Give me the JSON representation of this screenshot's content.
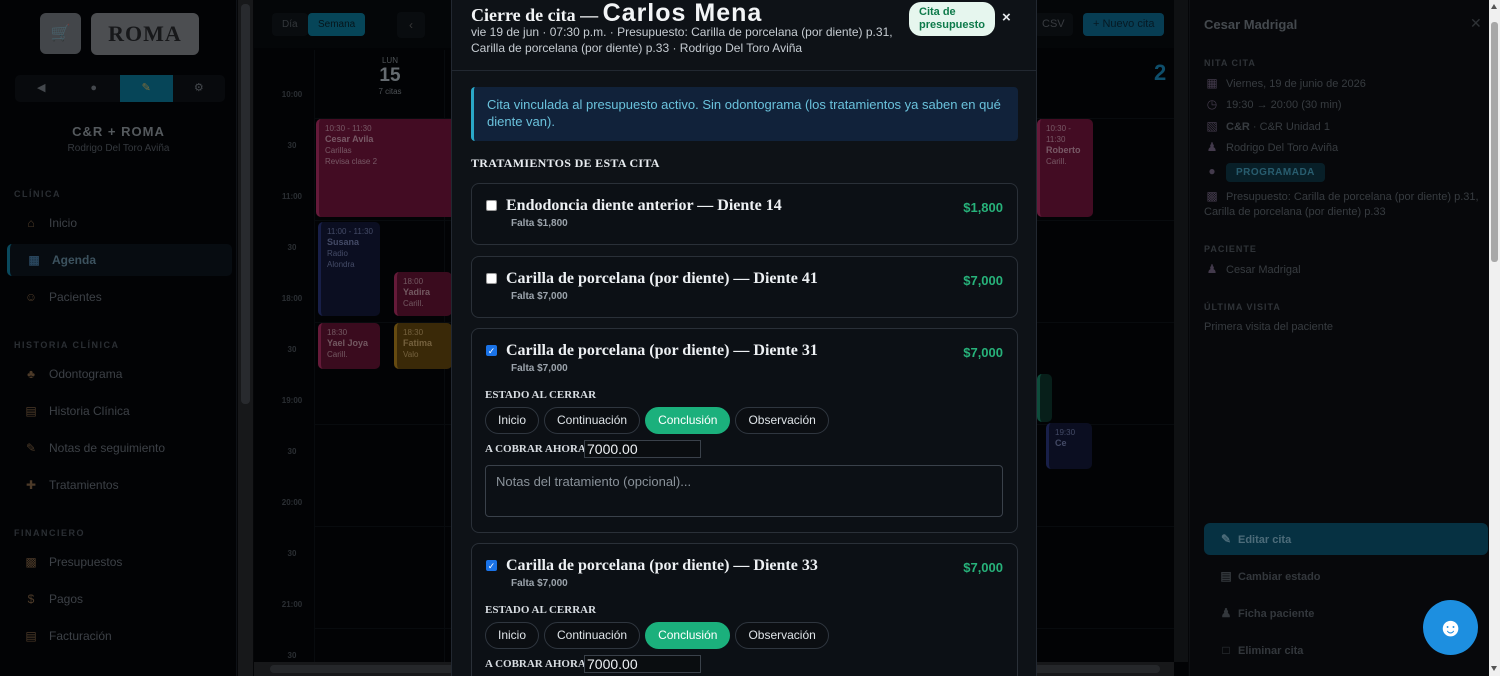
{
  "sidebar": {
    "logo_text": "ROMA",
    "clinic_name": "C&R + ROMA",
    "doctor": "Rodrigo Del Toro Aviña",
    "sections": {
      "clinica": "CLÍNICA",
      "historia": "HISTORIA CLÍNICA",
      "financiero": "FINANCIERO"
    },
    "nav": {
      "inicio": "Inicio",
      "agenda": "Agenda",
      "pacientes": "Pacientes",
      "odontograma": "Odontograma",
      "historia_clinica": "Historia Clínica",
      "notas": "Notas de seguimiento",
      "tratamientos": "Tratamientos",
      "presupuestos": "Presupuestos",
      "pagos": "Pagos",
      "facturacion": "Facturación"
    }
  },
  "calendar": {
    "view_day": "Día",
    "view_week": "Semana",
    "csv": "CSV",
    "new_appt": "+ Nuevo cita",
    "day_head": {
      "dow": "LUN",
      "num": "15",
      "count": "7 citas"
    },
    "times": [
      "10:00",
      "30",
      "11:00",
      "30",
      "18:00",
      "30",
      "19:00",
      "30",
      "20:00",
      "30",
      "21:00",
      "30"
    ],
    "events": {
      "e1": {
        "t": "10:30 - 11:30",
        "n": "Cesar Avila",
        "s": "Carillas",
        "x": "Revisa clase 2"
      },
      "e2": {
        "t": "11:00 - 11:30",
        "n": "Susana",
        "s": "Radio",
        "x": "Alondra"
      },
      "e3": {
        "t": "18:00",
        "n": "Yadira",
        "s": "Carill."
      },
      "e4": {
        "t": "18:30",
        "n": "Yael Joya",
        "s": "Carill."
      },
      "e5": {
        "t": "18:30",
        "n": "Fatima",
        "s": "Valo"
      },
      "e6": {
        "t": "10:30 - 11:30",
        "n": "Roberto",
        "s": "Carill."
      },
      "e7": {
        "t": "19:30",
        "n": "Ce"
      }
    }
  },
  "panel": {
    "title": "Cesar Madrigal",
    "cita_label": "NITA CITA",
    "date": "Viernes, 19 de junio de 2026",
    "time": "19:30 → 20:00 (30 min)",
    "unit_bold": "C&R",
    "unit": "· C&R Unidad 1",
    "doctor": "Rodrigo Del Toro Aviña",
    "status": "PROGRAMADA",
    "presupuesto": "Presupuesto: Carilla de porcelana (por diente) p.31, Carilla de porcelana (por diente) p.33",
    "paciente_label": "PACIENTE",
    "paciente": "Cesar Madrigal",
    "ultima_label": "ÚLTIMA VISITA",
    "ultima": "Primera visita del paciente",
    "btn_edit": "Editar cita",
    "btn_status": "Cambiar estado",
    "btn_ficha": "Ficha paciente",
    "btn_delete": "Eliminar cita"
  },
  "modal": {
    "title_prefix": "Cierre de cita —",
    "patient": "Carlos Mena",
    "subtitle": "vie 19 de jun · 07:30 p.m. · Presupuesto: Carilla de porcelana (por diente) p.31, Carilla de porcelana (por diente) p.33 · Rodrigo Del Toro Aviña",
    "pill": "Cita de presupuesto",
    "close": "×",
    "info": "Cita vinculada al presupuesto activo. Sin odontograma (los tratamientos ya saben en qué diente van).",
    "section": "TRATAMIENTOS DE ESTA CITA",
    "estado_label": "ESTADO AL CERRAR",
    "cobrar_label": "A COBRAR AHORA",
    "notes_placeholder": "Notas del tratamiento (opcional)...",
    "states": [
      "Inicio",
      "Continuación",
      "Conclusión",
      "Observación"
    ],
    "treatments": [
      {
        "name": "Endodoncia diente anterior — Diente 14",
        "falta": "Falta $1,800",
        "price": "$1,800",
        "checked": false
      },
      {
        "name": "Carilla de porcelana (por diente) — Diente 41",
        "falta": "Falta $7,000",
        "price": "$7,000",
        "checked": false
      },
      {
        "name": "Carilla de porcelana (por diente) — Diente 31",
        "falta": "Falta $7,000",
        "price": "$7,000",
        "checked": true,
        "cobrar": "7000.00",
        "selected_state": "Conclusión"
      },
      {
        "name": "Carilla de porcelana (por diente) — Diente 33",
        "falta": "Falta $7,000",
        "price": "$7,000",
        "checked": true,
        "cobrar": "7000.00",
        "selected_state": "Conclusión"
      }
    ]
  },
  "colors": {
    "accent": "#0c7fa0",
    "success": "#1bb07c",
    "pill_bg": "#e6f6ee"
  }
}
